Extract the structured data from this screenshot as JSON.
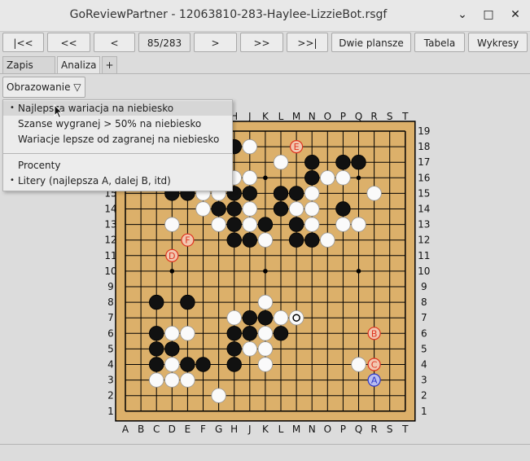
{
  "window": {
    "title": "GoReviewPartner - 12063810-283-Haylee-LizzieBot.rsgf",
    "minimize_glyph": "⌄",
    "maximize_glyph": "□",
    "close_glyph": "✕"
  },
  "nav": {
    "first": "|<<",
    "back10": "<<",
    "back": "<",
    "move_counter": "85/283",
    "forward": ">",
    "forward10": ">>",
    "last": ">>|",
    "two_boards": "Dwie plansze",
    "table": "Tabela",
    "charts": "Wykresy"
  },
  "tabs": [
    {
      "label": "Zapis gry"
    },
    {
      "label": "Analiza"
    },
    {
      "label": "+"
    }
  ],
  "display_dropdown": {
    "label": "Obrazowanie ▽"
  },
  "menu": {
    "items": [
      {
        "label": "Najlepsza wariacja na niebiesko",
        "selected": true,
        "highlighted": true
      },
      {
        "label": "Szanse wygranej > 50% na niebiesko",
        "selected": false
      },
      {
        "label": "Wariacje lepsze od zagranej na niebiesko",
        "selected": false
      },
      {
        "label": "Procenty",
        "selected": false
      },
      {
        "label": "Litery (najlepsza A, dalej B, itd)",
        "selected": true
      }
    ],
    "bullet": "•"
  },
  "board": {
    "size": 19,
    "columns": [
      "A",
      "B",
      "C",
      "D",
      "E",
      "F",
      "G",
      "H",
      "J",
      "K",
      "L",
      "M",
      "N",
      "O",
      "P",
      "Q",
      "R",
      "S",
      "T"
    ],
    "rows": [
      "19",
      "18",
      "17",
      "16",
      "15",
      "14",
      "13",
      "12",
      "11",
      "10",
      "9",
      "8",
      "7",
      "6",
      "5",
      "4",
      "3",
      "2",
      "1"
    ],
    "board_color": "#dcb06a",
    "black_stones": [
      "H18",
      "P17",
      "Q17",
      "N17",
      "D15",
      "E15",
      "H15",
      "J15",
      "L15",
      "M15",
      "N16",
      "G14",
      "H14",
      "L14",
      "P14",
      "H13",
      "K13",
      "M13",
      "H12",
      "J12",
      "M12",
      "N12",
      "C8",
      "E8",
      "C6",
      "H6",
      "J6",
      "L6",
      "C5",
      "D5",
      "H5",
      "C4",
      "E4",
      "F4",
      "H4",
      "J7",
      "K7"
    ],
    "white_stones": [
      "J18",
      "L17",
      "O16",
      "P16",
      "H16",
      "J16",
      "F15",
      "G15",
      "N15",
      "R15",
      "F14",
      "J14",
      "M14",
      "N14",
      "D13",
      "G13",
      "J13",
      "N13",
      "P13",
      "Q13",
      "K12",
      "O12",
      "K8",
      "H7",
      "L7",
      "D6",
      "E6",
      "K6",
      "J5",
      "K5",
      "D4",
      "K4",
      "Q4",
      "C3",
      "D3",
      "E3",
      "G2"
    ],
    "last_move": "M7",
    "star_points": [
      "D16",
      "K16",
      "Q16",
      "D10",
      "K10",
      "Q10",
      "D4",
      "K4",
      "Q4"
    ],
    "red_markers": [
      {
        "pos": "M18",
        "letter": "E"
      },
      {
        "pos": "E12",
        "letter": "F"
      },
      {
        "pos": "D11",
        "letter": "D"
      },
      {
        "pos": "R6",
        "letter": "B"
      },
      {
        "pos": "R4",
        "letter": "C"
      }
    ],
    "blue_markers": [
      {
        "pos": "R3",
        "letter": "A"
      }
    ],
    "colors": {
      "red_marker": "#e0321e",
      "blue_marker": "#2a35c8",
      "marker_fill": "#f2c7b0",
      "blue_fill": "#b9bdf0"
    }
  }
}
